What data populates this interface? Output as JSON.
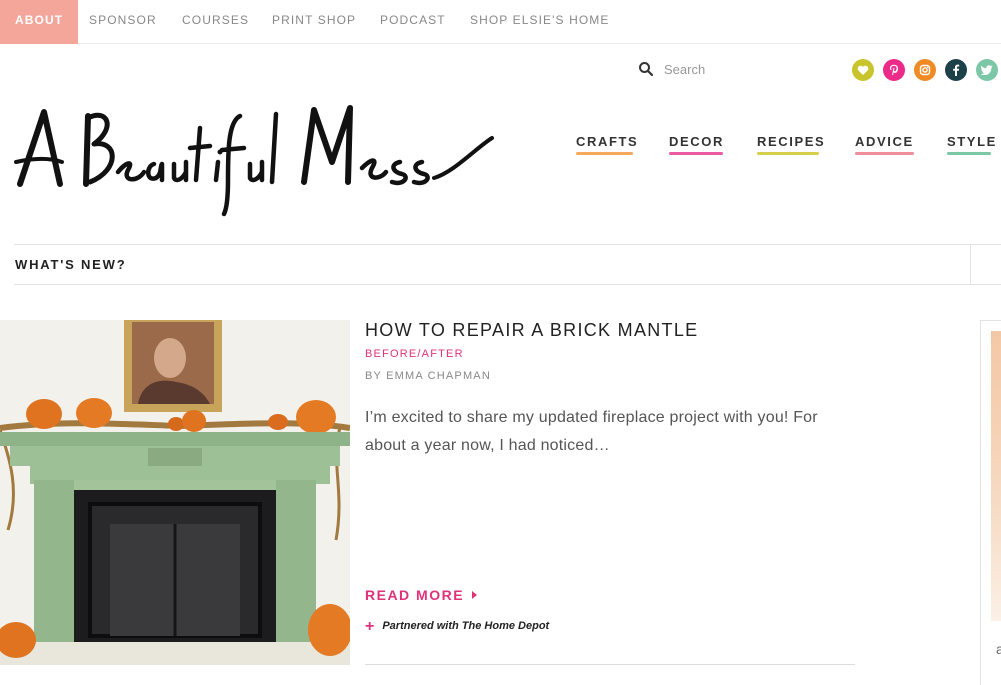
{
  "topnav": {
    "items": [
      {
        "label": "ABOUT",
        "active": true
      },
      {
        "label": "SPONSOR"
      },
      {
        "label": "COURSES"
      },
      {
        "label": "PRINT SHOP"
      },
      {
        "label": "PODCAST"
      },
      {
        "label": "SHOP ELSIE'S HOME"
      }
    ],
    "active_color": "#f4a69b"
  },
  "search": {
    "placeholder": "Search",
    "icon": "search-icon"
  },
  "social": [
    {
      "name": "heart-icon",
      "color": "#c9c42b"
    },
    {
      "name": "pinterest-icon",
      "color": "#ec2a8a"
    },
    {
      "name": "instagram-icon",
      "color": "#f08a24"
    },
    {
      "name": "facebook-icon",
      "color": "#1d4149"
    },
    {
      "name": "twitter-icon",
      "color": "#7cc8a6"
    }
  ],
  "logo": {
    "alt": "A Beautiful Mess"
  },
  "mainnav": {
    "items": [
      {
        "label": "CRAFTS",
        "underline": "#f6a95a"
      },
      {
        "label": "DECOR",
        "underline": "#ec5aa0"
      },
      {
        "label": "RECIPES",
        "underline": "#d5cf4a"
      },
      {
        "label": "ADVICE",
        "underline": "#f28e9b"
      },
      {
        "label": "STYLE",
        "underline": "#7cc8a6"
      }
    ]
  },
  "whatsnew": {
    "label": "WHAT'S NEW?"
  },
  "post": {
    "title": "HOW TO REPAIR A BRICK MANTLE",
    "category": "BEFORE/AFTER",
    "author": "BY EMMA CHAPMAN",
    "excerpt": "I’m excited to share my updated fireplace project with you! For about a year now, I had noticed…",
    "read_more": "READ MORE",
    "partner": "Partnered with The Home Depot",
    "accent": "#e0327a"
  },
  "sidebar": {
    "partial_text": "a"
  }
}
